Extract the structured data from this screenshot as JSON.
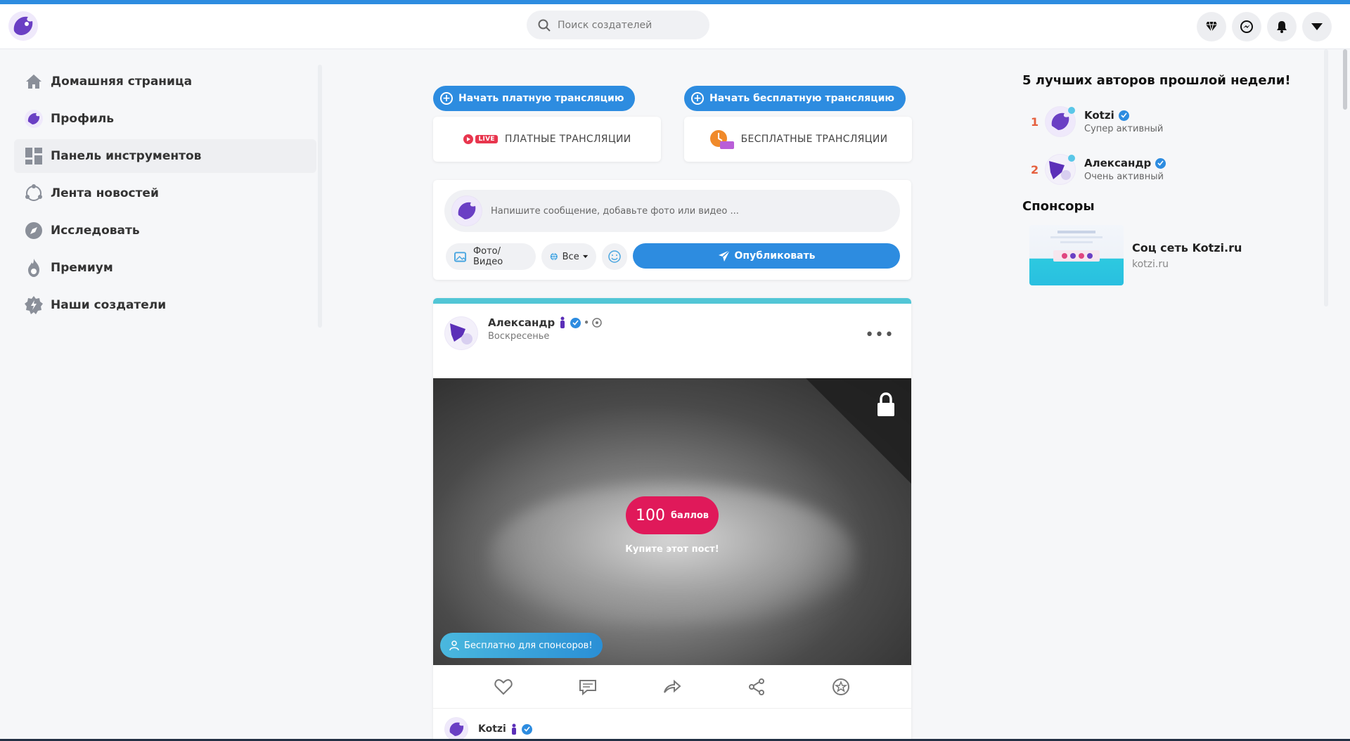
{
  "header": {
    "search_placeholder": "Поиск создателей"
  },
  "sidebar": {
    "items": [
      {
        "label": "Домашняя страница"
      },
      {
        "label": "Профиль"
      },
      {
        "label": "Панель инструментов"
      },
      {
        "label": "Лента новостей"
      },
      {
        "label": "Исследовать"
      },
      {
        "label": "Премиум"
      },
      {
        "label": "Наши создатели"
      }
    ]
  },
  "streams": {
    "paid_button": "Начать платную трансляцию",
    "free_button": "Начать бесплатную трансляцию",
    "paid_card": "ПЛАТНЫЕ ТРАНСЛЯЦИИ",
    "free_card": "БЕСПЛАТНЫЕ ТРАНСЛЯЦИИ",
    "live_badge": "LIVE"
  },
  "composer": {
    "placeholder": "Напишите сообщение, добавьте фото или видео ...",
    "photo_video": "Фото/Видео",
    "audience": "Все",
    "publish": "Опубликовать"
  },
  "post": {
    "author": "Александр",
    "date": "Воскресенье",
    "price": "100",
    "price_unit": "баллов",
    "buy_text": "Купите этот пост!",
    "sponsor_free": "Бесплатно для спонсоров!",
    "comment_author": "Kotzi"
  },
  "right": {
    "top_title": "5 лучших авторов прошлой недели!",
    "top_authors": [
      {
        "rank": "1",
        "name": "Kotzi",
        "status": "Супер активный"
      },
      {
        "rank": "2",
        "name": "Александр",
        "status": "Очень активный"
      }
    ],
    "sponsors_title": "Спонсоры",
    "sponsor": {
      "title": "Соц сеть Kotzi.ru",
      "url": "kotzi.ru"
    }
  },
  "colors": {
    "accent": "#2d8ce0",
    "price": "#e0195a",
    "rank": "#e5603e",
    "post_top": "#52c6d6"
  }
}
